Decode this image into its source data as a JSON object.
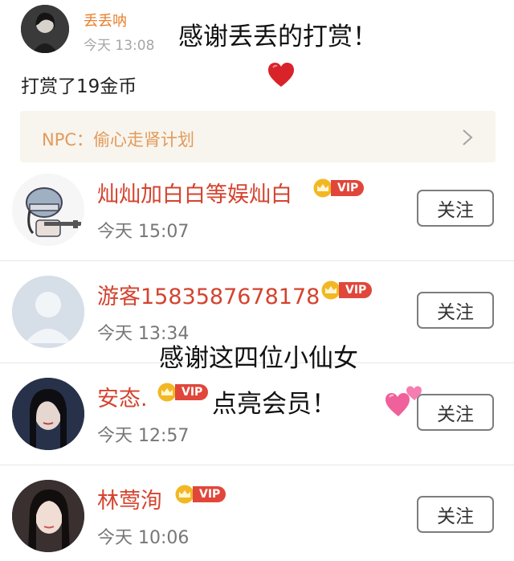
{
  "top_comment": {
    "user_name": "丢丢呐",
    "time": "今天 13:08",
    "text": "打赏了19金币",
    "overlay_text": "感谢丢丢的打赏！",
    "heart_icon": "red-heart-emoji"
  },
  "npc_banner": {
    "text": "NPC：偷心走肾计划",
    "chevron_icon": "chevron-right-icon"
  },
  "rows": [
    {
      "name": "灿灿加白白等娱灿白",
      "time": "今天 15:07",
      "vip": "VIP",
      "follow": "关注"
    },
    {
      "name": "游客1583587678178",
      "time": "今天 13:34",
      "vip": "VIP",
      "follow": "关注"
    },
    {
      "name": "安态.",
      "time": "今天 12:57",
      "vip": "VIP",
      "follow": "关注"
    },
    {
      "name": "林莺洵",
      "time": "今天 10:06",
      "vip": "VIP",
      "follow": "关注"
    }
  ],
  "overlay": {
    "line1": "感谢这四位小仙女",
    "line2": "点亮会员！",
    "hearts_icon": "two-hearts-emoji"
  },
  "colors": {
    "name_red": "#d4432f",
    "name_orange": "#e8812f",
    "vip_red": "#e0473a",
    "crown_gold": "#f2b824",
    "npc_bg": "#f7f5ee"
  }
}
